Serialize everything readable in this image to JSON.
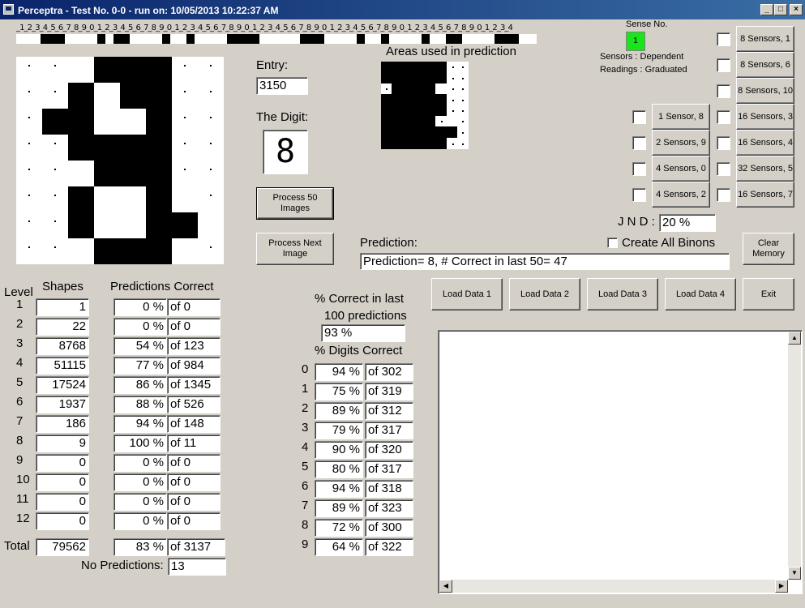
{
  "window": {
    "title": "Perceptra - Test No. 0-0 - run on: 10/05/2013  10:22:37 AM",
    "min": "_",
    "max": "□",
    "close": "×"
  },
  "ruler": {
    "text": "_1_2_3_4_5_6_7_8_9_0_1_2_3_4_5_6_7_8_9_0_1_2_3_4_5_6_7_8_9_0_1_2_3_4_5_6_7_8_9_0_1_2_3_4_5_6_7_8_9_0_1_2_3_4_5_6_7_8_9_0_1_2_3_4"
  },
  "entry": {
    "label": "Entry:",
    "value": "3150"
  },
  "digit": {
    "label": "The Digit:",
    "value": "8"
  },
  "areas_title": "Areas used in prediction",
  "sense": {
    "label": "Sense No.",
    "value": "1",
    "sensors_line": "Sensors   :  Dependent",
    "readings_line": "Readings : Graduated"
  },
  "sensor_buttons": [
    "8 Sensors, 1",
    "8 Sensors, 6",
    "8 Sensors, 10",
    "16 Sensors, 3",
    "16 Sensors, 4",
    "32 Sensors, 5",
    "16 Sensors, 7"
  ],
  "sensor_buttons_left": [
    "1 Sensor, 8",
    "2 Sensors, 9",
    "4 Sensors, 0",
    "4 Sensors, 2"
  ],
  "jnd": {
    "label": "J N D :",
    "value": "20 %"
  },
  "buttons": {
    "process50": "Process 50 Images",
    "process_next": "Process Next Image",
    "clear_memory": "Clear Memory",
    "load1": "Load Data 1",
    "load2": "Load Data 2",
    "load3": "Load Data 3",
    "load4": "Load Data 4",
    "exit": "Exit"
  },
  "create_all_binons": "Create All Binons",
  "prediction": {
    "label": "Prediction:",
    "value": "Prediction= 8, # Correct in last 50= 47"
  },
  "levels_header": {
    "level": "Level",
    "shapes": "Shapes",
    "pred": "Predictions Correct"
  },
  "levels": [
    {
      "level": "1",
      "shapes": "1",
      "pct": "0 %",
      "of": "of 0"
    },
    {
      "level": "2",
      "shapes": "22",
      "pct": "0 %",
      "of": "of 0"
    },
    {
      "level": "3",
      "shapes": "8768",
      "pct": "54 %",
      "of": "of 123"
    },
    {
      "level": "4",
      "shapes": "51115",
      "pct": "77 %",
      "of": "of 984"
    },
    {
      "level": "5",
      "shapes": "17524",
      "pct": "86 %",
      "of": "of 1345"
    },
    {
      "level": "6",
      "shapes": "1937",
      "pct": "88 %",
      "of": "of 526"
    },
    {
      "level": "7",
      "shapes": "186",
      "pct": "94 %",
      "of": "of 148"
    },
    {
      "level": "8",
      "shapes": "9",
      "pct": "100 %",
      "of": "of 11"
    },
    {
      "level": "9",
      "shapes": "0",
      "pct": "0 %",
      "of": "of 0"
    },
    {
      "level": "10",
      "shapes": "0",
      "pct": "0 %",
      "of": "of 0"
    },
    {
      "level": "11",
      "shapes": "0",
      "pct": "0 %",
      "of": "of 0"
    },
    {
      "level": "12",
      "shapes": "0",
      "pct": "0 %",
      "of": "of 0"
    }
  ],
  "total": {
    "label": "Total",
    "shapes": "79562",
    "pct": "83 %",
    "of": "of 3137"
  },
  "no_predictions": {
    "label": "No Predictions:",
    "value": "13"
  },
  "correct100": {
    "label1": "% Correct in last",
    "label2": "100 predictions",
    "value": "93 %"
  },
  "digits_header": "% Digits Correct",
  "digits": [
    {
      "d": "0",
      "pct": "94 %",
      "of": "of 302"
    },
    {
      "d": "1",
      "pct": "75 %",
      "of": "of 319"
    },
    {
      "d": "2",
      "pct": "89 %",
      "of": "of 312"
    },
    {
      "d": "3",
      "pct": "79 %",
      "of": "of 317"
    },
    {
      "d": "4",
      "pct": "90 %",
      "of": "of 320"
    },
    {
      "d": "5",
      "pct": "80 %",
      "of": "of 317"
    },
    {
      "d": "6",
      "pct": "94 %",
      "of": "of 318"
    },
    {
      "d": "7",
      "pct": "89 %",
      "of": "of 323"
    },
    {
      "d": "8",
      "pct": "72 %",
      "of": "of 300"
    },
    {
      "d": "9",
      "pct": "64 %",
      "of": "of 322"
    }
  ]
}
